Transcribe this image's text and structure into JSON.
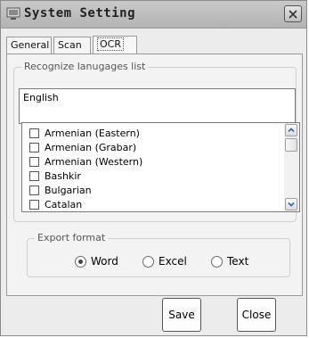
{
  "window": {
    "title": "System Setting"
  },
  "tabs": [
    {
      "label": "General"
    },
    {
      "label": "Scan"
    },
    {
      "label": "OCR",
      "active": true
    }
  ],
  "ocr": {
    "recognize": {
      "legend": "Recognize lanugages list",
      "value": "English"
    },
    "languages": [
      {
        "label": "Armenian (Eastern)",
        "checked": false
      },
      {
        "label": "Armenian (Grabar)",
        "checked": false
      },
      {
        "label": "Armenian (Western)",
        "checked": false
      },
      {
        "label": "Bashkir",
        "checked": false
      },
      {
        "label": "Bulgarian",
        "checked": false
      },
      {
        "label": "Catalan",
        "checked": false
      }
    ],
    "export": {
      "legend": "Export format",
      "options": [
        {
          "label": "Word",
          "selected": true
        },
        {
          "label": "Excel",
          "selected": false
        },
        {
          "label": "Text",
          "selected": false
        }
      ]
    }
  },
  "buttons": {
    "save": "Save",
    "close": "Close"
  }
}
